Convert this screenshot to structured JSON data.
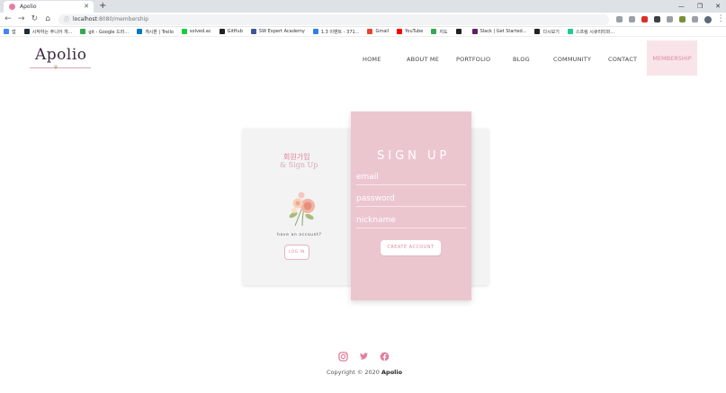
{
  "browser": {
    "tab_title": "Apolio",
    "url_host": "localhost",
    "url_rest": ":8080/membership",
    "bookmarks": [
      {
        "label": "앱",
        "color": "#4285f4"
      },
      {
        "label": "시작하는 주니어 개...",
        "color": "#1f2d3d"
      },
      {
        "label": "git - Google 드라...",
        "color": "#34a853"
      },
      {
        "label": "게시판 | Trello",
        "color": "#0079bf"
      },
      {
        "label": "solved.ac",
        "color": "#17ce3a"
      },
      {
        "label": "GitHub",
        "color": "#222222"
      },
      {
        "label": "SW Expert Academy",
        "color": "#3b5998"
      },
      {
        "label": "1.3 이벤트 - 371...",
        "color": "#2f80ed"
      },
      {
        "label": "Gmail",
        "color": "#ea4335"
      },
      {
        "label": "YouTube",
        "color": "#ff0000"
      },
      {
        "label": "지도",
        "color": "#34a853"
      },
      {
        "label": "",
        "color": "#222222"
      },
      {
        "label": "Slack | Get Started...",
        "color": "#611f69"
      },
      {
        "label": "다시보기",
        "color": "#222222"
      },
      {
        "label": "스프링 시큐리티와...",
        "color": "#20c997"
      }
    ],
    "extension_colors": [
      "#9aa0a6",
      "#9aa0a6",
      "#d93025",
      "#3c4043",
      "#9aa0a6",
      "#7a8f3a",
      "#9aa0a6"
    ]
  },
  "site": {
    "logo": "Apolio",
    "nav": [
      "HOME",
      "ABOUT ME",
      "PORTFOLIO",
      "BLOG",
      "COMMUNITY",
      "CONTACT",
      "MEMBERSHIP"
    ],
    "accent": "#e08aa3"
  },
  "signup": {
    "left_title_ko": "회원가입",
    "left_title_en": "& Sign Up",
    "have_account": "have an account?",
    "login_label": "LOG IN",
    "title": "SIGN UP",
    "email_placeholder": "email",
    "password_placeholder": "password",
    "nickname_placeholder": "nickname",
    "create_label": "CREATE ACCOUNT"
  },
  "footer": {
    "social": [
      "instagram-icon",
      "twitter-icon",
      "facebook-icon"
    ],
    "copyright_prefix": "Copyright © 2020",
    "copyright_brand": "Apolio"
  }
}
